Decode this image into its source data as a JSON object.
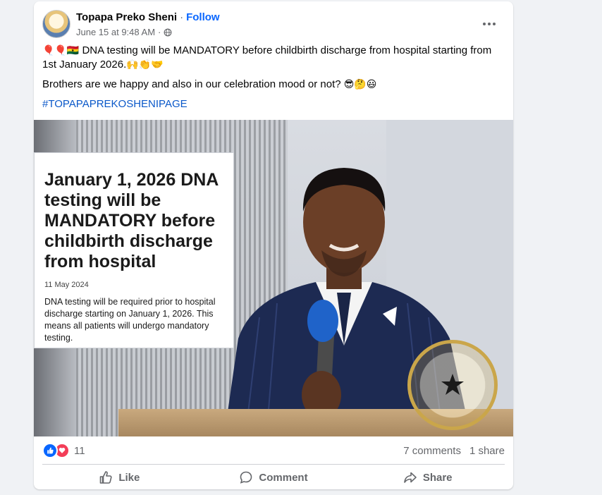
{
  "post": {
    "author": "Topapa Preko Sheni",
    "separator": "·",
    "follow_label": "Follow",
    "timestamp": "June 15 at 9:48 AM",
    "meta_separator": "·",
    "text_flags": "🎈🎈🇬🇭",
    "text_line1": " DNA testing will be MANDATORY before childbirth discharge from hospital starting from 1st January 2026.",
    "text_line1_emoji": "🙌👏🤝",
    "text_line2": "Brothers are we happy and also in our celebration mood or not?",
    "text_line2_emoji": "😎🤔😃",
    "hashtag": "#TOPAPAPREKOSHENIPAGE"
  },
  "image": {
    "news_title": "January 1, 2026 DNA testing will be MANDATORY before childbirth discharge from hospital",
    "news_date": "11 May 2024",
    "news_body": "DNA testing will be required prior to hospital discharge starting on January 1, 2026. This means all patients will undergo mandatory testing."
  },
  "stats": {
    "reaction_count": "11",
    "comments": "7 comments",
    "shares": "1 share"
  },
  "actions": {
    "like": "Like",
    "comment": "Comment",
    "share": "Share"
  },
  "icons": {
    "like_reaction": "thumbs-up-icon",
    "love_reaction": "heart-icon",
    "privacy": "globe-icon",
    "more": "more-options-icon"
  },
  "colors": {
    "accent": "#0866ff",
    "love": "#f33e58",
    "hashtag": "#0a58c9",
    "muted": "#65676b"
  }
}
